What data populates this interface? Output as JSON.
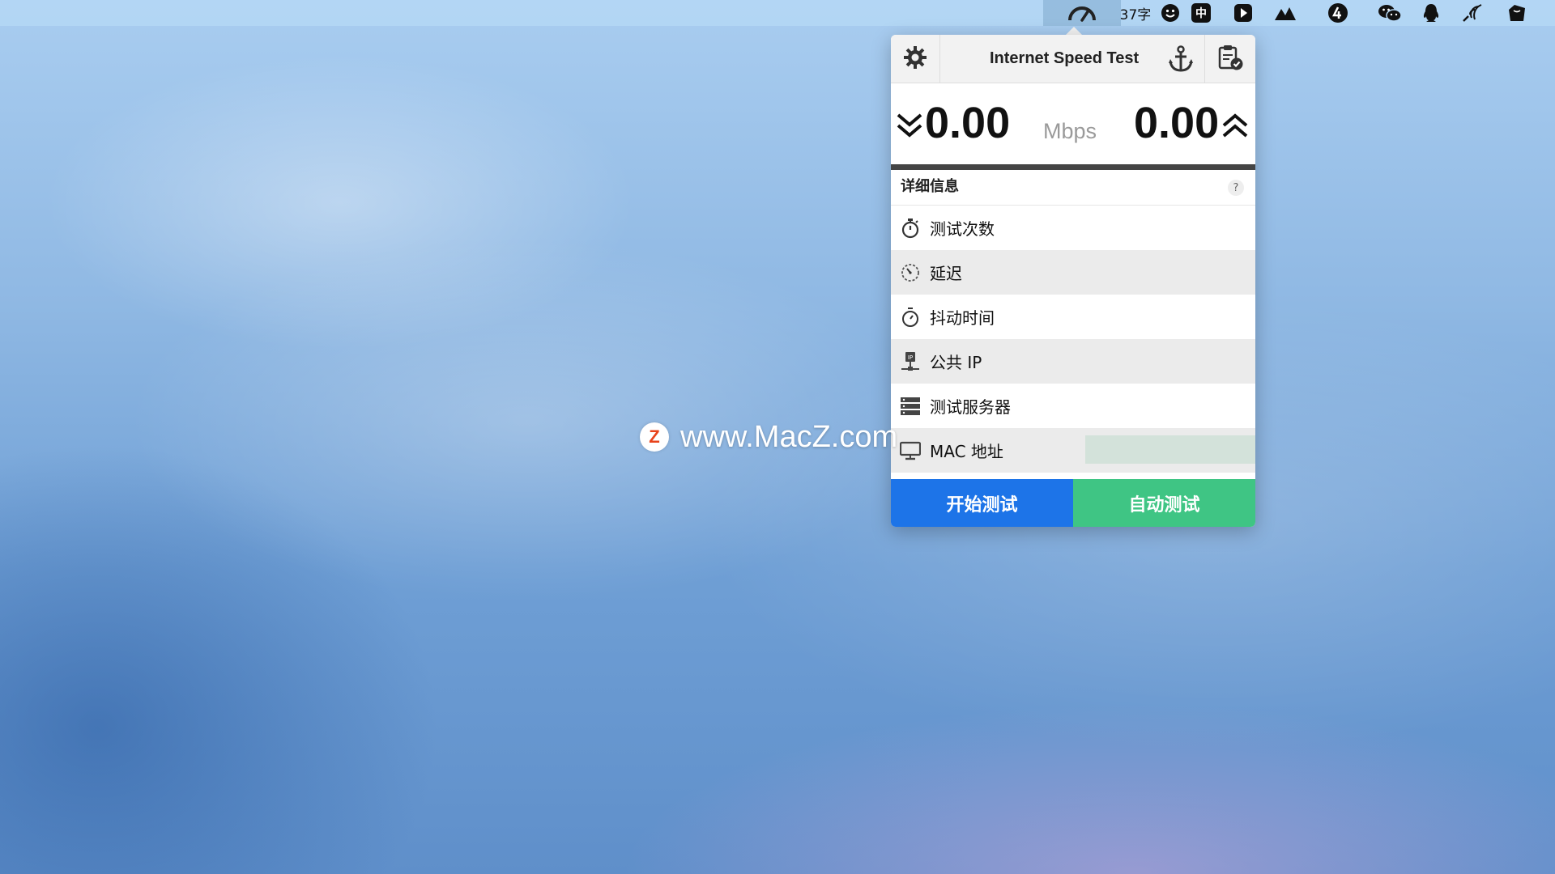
{
  "menubar": {
    "input_method_text": "37字",
    "ime_label": "中"
  },
  "popup": {
    "title": "Internet Speed Test",
    "download_speed": "0.00",
    "upload_speed": "0.00",
    "unit": "Mbps",
    "progress_percent": 0,
    "details_title": "详细信息",
    "help_label": "?",
    "rows": [
      {
        "label": "测试次数",
        "icon": "stopwatch-icon"
      },
      {
        "label": "延迟",
        "icon": "latency-gauge-icon"
      },
      {
        "label": "抖动时间",
        "icon": "timer-icon"
      },
      {
        "label": "公共 IP",
        "icon": "ip-network-icon"
      },
      {
        "label": "测试服务器",
        "icon": "server-icon"
      },
      {
        "label": "MAC 地址",
        "icon": "monitor-icon"
      }
    ],
    "start_button": "开始测试",
    "auto_button": "自动测试"
  },
  "watermark": {
    "logo_letter": "Z",
    "text": "www.MacZ.com"
  }
}
